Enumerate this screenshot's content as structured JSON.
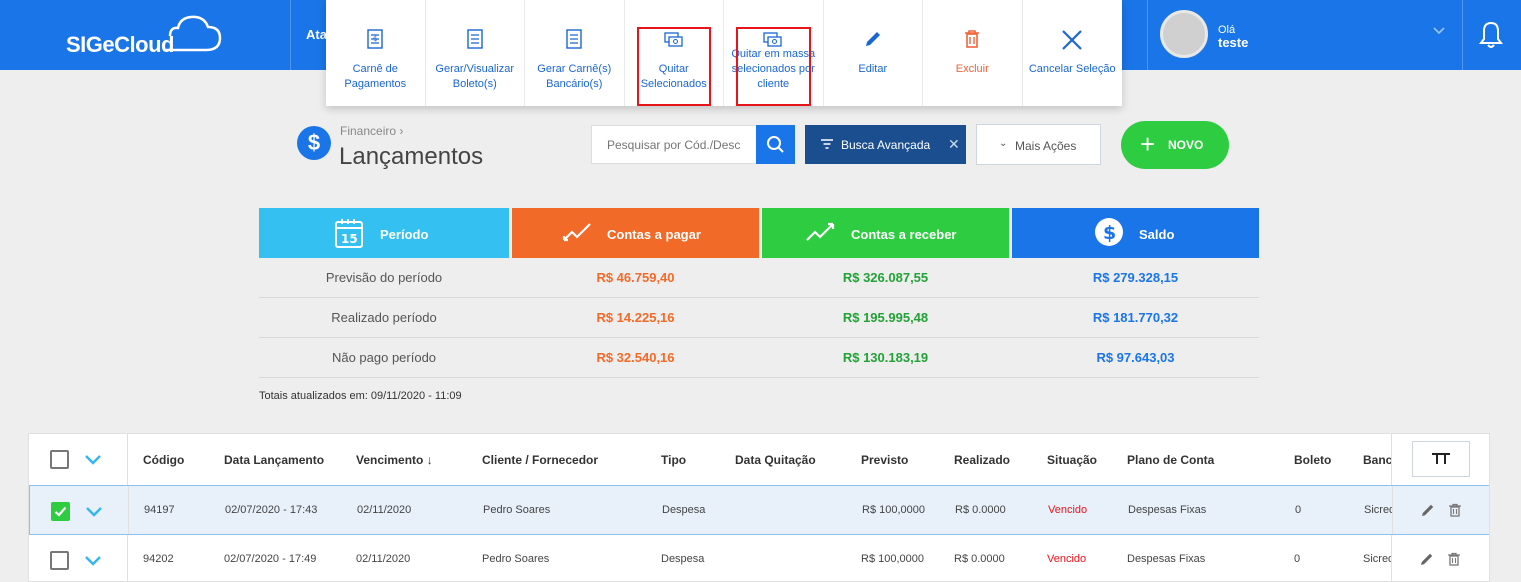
{
  "header": {
    "logo": "SIGeCloud",
    "partial_nav": "Ata",
    "user_greeting": "Olá",
    "user_name": "teste"
  },
  "actions_menu": [
    {
      "label": "Carnê de Pagamentos",
      "icon": "document-icon"
    },
    {
      "label": "Gerar/Visualizar Boleto(s)",
      "icon": "document-icon"
    },
    {
      "label": "Gerar Carnê(s) Bancário(s)",
      "icon": "document-icon"
    },
    {
      "label": "Quitar Selecionados",
      "icon": "money-icon"
    },
    {
      "label": "Quitar em massa selecionados por cliente",
      "icon": "money-icon"
    },
    {
      "label": "Editar",
      "icon": "pencil-icon"
    },
    {
      "label": "Excluir",
      "icon": "trash-icon"
    },
    {
      "label": "Cancelar Seleção",
      "icon": "close-icon"
    }
  ],
  "page": {
    "breadcrumb": "Financeiro",
    "title": "Lançamentos",
    "search_placeholder": "Pesquisar por Cód./Desc",
    "advanced_search": "Busca Avançada",
    "more_actions": "Mais Ações",
    "new_button": "NOVO"
  },
  "summary": {
    "cards": {
      "periodo": "Período",
      "periodo_day": "15",
      "pagar": "Contas a pagar",
      "receber": "Contas a receber",
      "saldo": "Saldo"
    },
    "rows": [
      {
        "label": "Previsão do período",
        "pagar": "R$ 46.759,40",
        "receber": "R$ 326.087,55",
        "saldo": "R$ 279.328,15"
      },
      {
        "label": "Realizado período",
        "pagar": "R$ 14.225,16",
        "receber": "R$ 195.995,48",
        "saldo": "R$ 181.770,32"
      },
      {
        "label": "Não pago período",
        "pagar": "R$ 32.540,16",
        "receber": "R$ 130.183,19",
        "saldo": "R$ 97.643,03"
      }
    ],
    "totals_note": "Totais atualizados em: 09/11/2020 - 11:09"
  },
  "table": {
    "columns": [
      "Código",
      "Data Lançamento",
      "Vencimento",
      "Cliente / Fornecedor",
      "Tipo",
      "Data Quitação",
      "Previsto",
      "Realizado",
      "Situação",
      "Plano de Conta",
      "Boleto",
      "Banco"
    ],
    "sort_indicator": "↓",
    "rows": [
      {
        "codigo": "94197",
        "data_lancamento": "02/07/2020 - 17:43",
        "vencimento": "02/11/2020",
        "cliente": "Pedro Soares",
        "tipo": "Despesa",
        "data_quitacao": "",
        "previsto": "R$ 100,0000",
        "realizado": "R$ 0.0000",
        "situacao": "Vencido",
        "plano": "Despesas Fixas",
        "boleto": "0",
        "banco": "Sicredi",
        "selected": true
      },
      {
        "codigo": "94202",
        "data_lancamento": "02/07/2020 - 17:49",
        "vencimento": "02/11/2020",
        "cliente": "Pedro Soares",
        "tipo": "Despesa",
        "data_quitacao": "",
        "previsto": "R$ 100,0000",
        "realizado": "R$ 0.0000",
        "situacao": "Vencido",
        "plano": "Despesas Fixas",
        "boleto": "0",
        "banco": "Sicredi",
        "selected": false
      }
    ]
  },
  "colors": {
    "brand_blue": "#1a75e8",
    "orange": "#f26a28",
    "green": "#2ecc40",
    "cyan": "#35c0f2",
    "red_highlight": "#e8141c"
  }
}
